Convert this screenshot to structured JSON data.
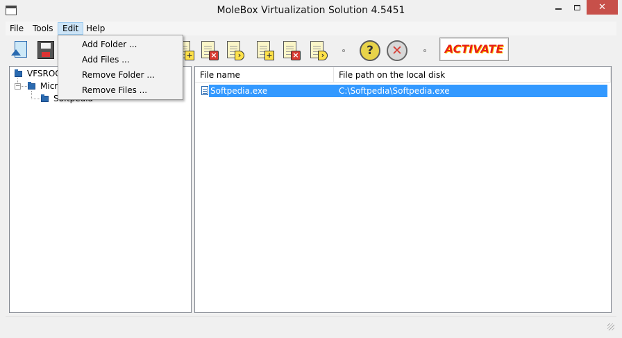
{
  "window": {
    "title": "MoleBox Virtualization Solution 4.5451",
    "close_glyph": "✕"
  },
  "menubar": {
    "items": [
      {
        "label": "File"
      },
      {
        "label": "Tools"
      },
      {
        "label": "Edit"
      },
      {
        "label": "Help"
      }
    ]
  },
  "edit_menu": {
    "items": [
      {
        "label": "Add Folder ..."
      },
      {
        "label": "Add Files ..."
      },
      {
        "label": "Remove Folder ..."
      },
      {
        "label": "Remove Files ..."
      }
    ]
  },
  "toolbar": {
    "help_glyph": "?",
    "stop_glyph": "✕",
    "activate_label": "ACTIVATE",
    "icons": [
      "open-project-icon",
      "save-project-icon",
      "add-folder-icon",
      "remove-folder-icon",
      "rename-folder-icon",
      "add-file-icon",
      "remove-file-icon",
      "rename-file-icon",
      "help-icon",
      "stop-icon"
    ]
  },
  "tree": {
    "nodes": [
      {
        "label": "VFSROOT"
      },
      {
        "label": "Microsoft"
      },
      {
        "label": "Softpedia"
      }
    ]
  },
  "file_list": {
    "columns": [
      "File name",
      "File path on the local disk"
    ],
    "rows": [
      {
        "name": "Softpedia.exe",
        "path": "C:\\Softpedia\\Softpedia.exe"
      }
    ]
  },
  "colors": {
    "selection": "#3399ff",
    "menu_highlight": "#cce4f7",
    "close_button": "#c7504a",
    "activate_text": "#e8201a"
  }
}
